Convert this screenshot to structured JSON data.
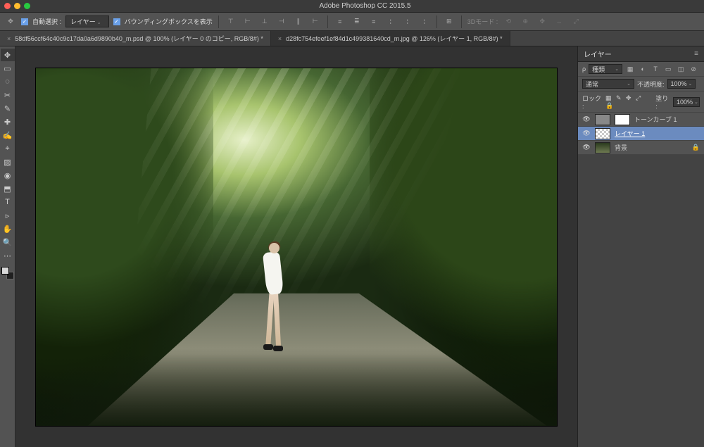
{
  "app_title": "Adobe Photoshop CC 2015.5",
  "options": {
    "move_icon": "✥",
    "auto_select_chk": "✓",
    "auto_select_label": "自動選択 :",
    "auto_select_target": "レイヤー",
    "bbox_chk": "✓",
    "bbox_label": "バウンディングボックスを表示",
    "mode3d_label": "3Dモード :"
  },
  "tabs": [
    {
      "label": "58df56ccf64c40c9c17da0a6d9890b40_m.psd @ 100% (レイヤー 0 のコピー, RGB/8#) *",
      "active": false
    },
    {
      "label": "d28fc754efeef1ef84d1c499381640cd_m.jpg @ 126% (レイヤー 1, RGB/8#) *",
      "active": true
    }
  ],
  "tools": [
    "✥",
    "▭",
    "◌",
    "✂",
    "✎",
    "✚",
    "✍",
    "⌖",
    "▨",
    "◉",
    "⬒",
    "T",
    "▹",
    "✋",
    "🔍"
  ],
  "layers_panel": {
    "title": "レイヤー",
    "filter_kind": "種類",
    "blend_mode": "通常",
    "opacity_label": "不透明度:",
    "opacity_value": "100%",
    "lock_label": "ロック :",
    "lock_icons": "▦ ✎ ✥ ⤢ 🔒",
    "fill_label": "塗り :",
    "fill_value": "100%",
    "layers": [
      {
        "name": "トーンカーブ 1",
        "type": "adj"
      },
      {
        "name": "レイヤー 1",
        "type": "layer",
        "selected": true
      },
      {
        "name": "背景",
        "type": "bg",
        "locked": true
      }
    ]
  }
}
